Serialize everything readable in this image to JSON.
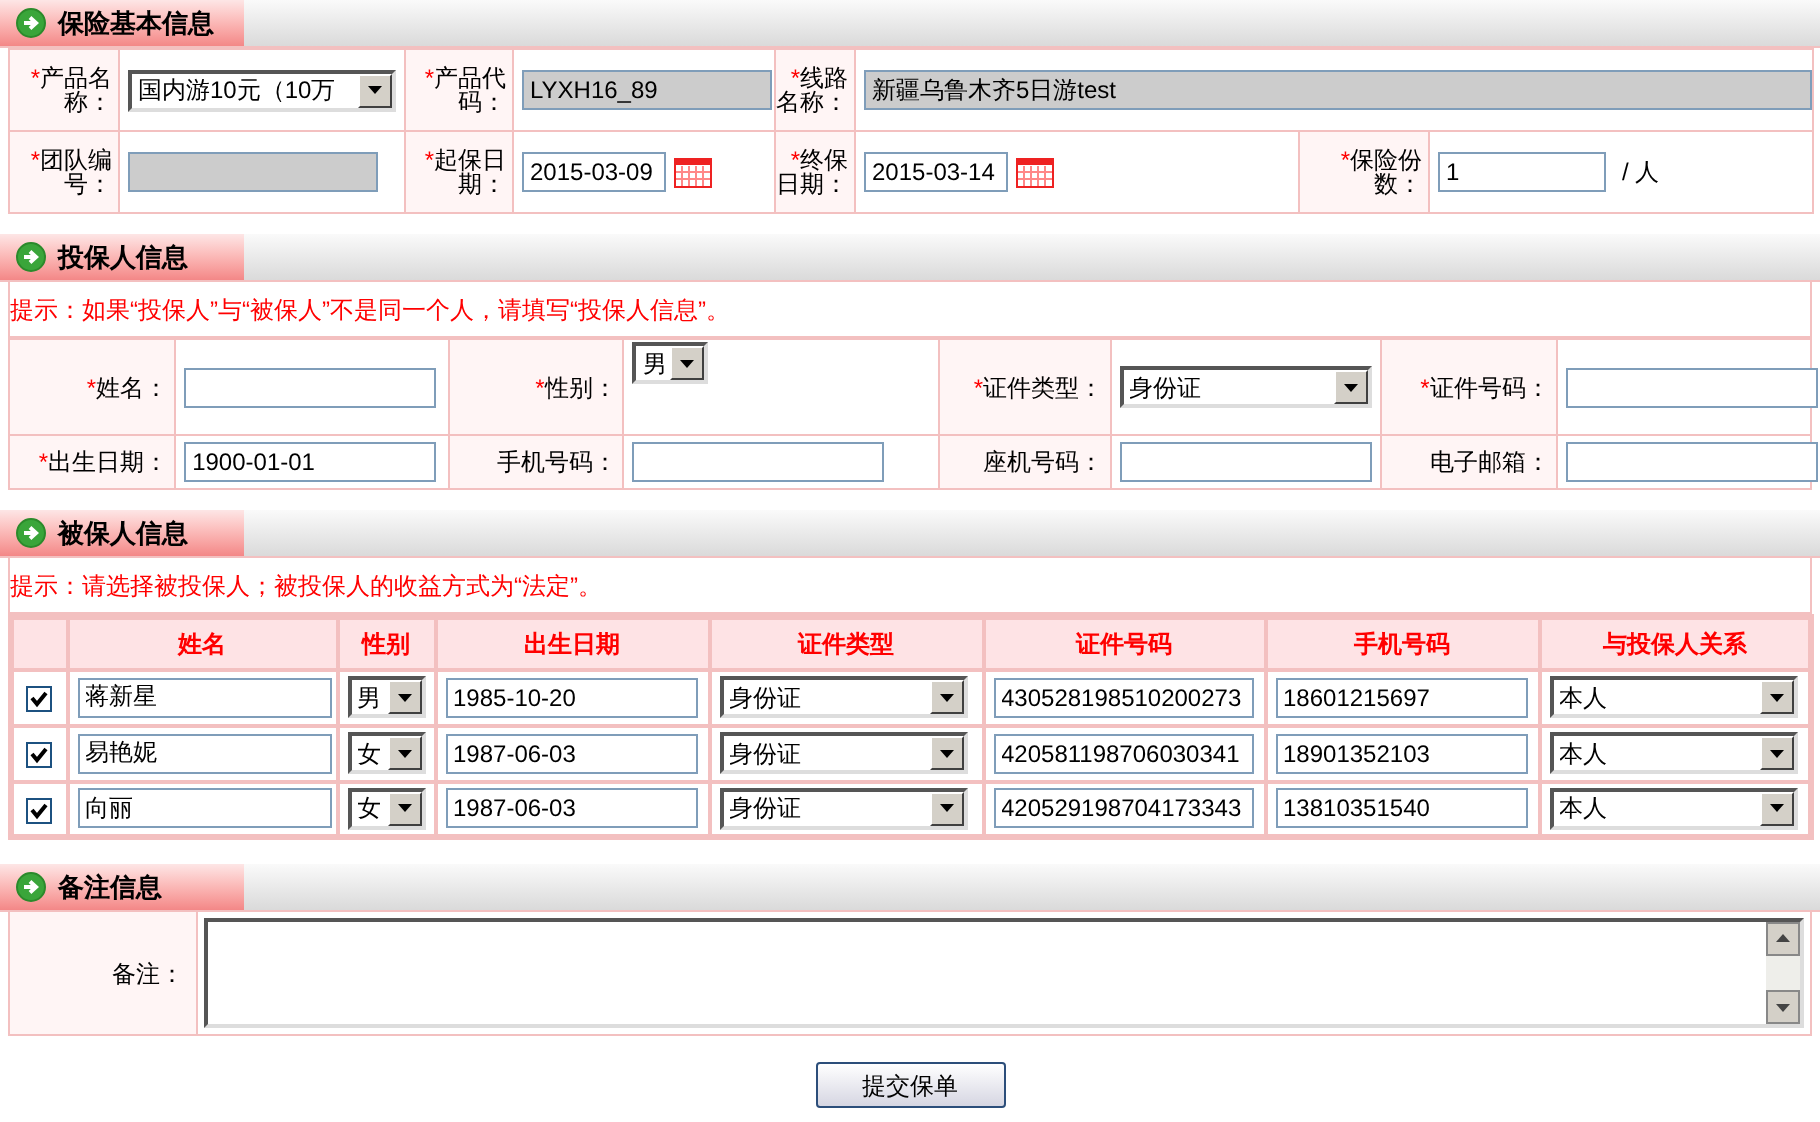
{
  "sections": [
    {
      "kind": "form",
      "title": "保险基本信息",
      "rows": [
        [
          {
            "kind": "select",
            "required_mark": "*",
            "label": "产品名称：",
            "value": "国内游10元（10万"
          },
          {
            "kind": "readonly",
            "required_mark": "*",
            "label": "产品代码：",
            "value": "LYXH16_89"
          },
          {
            "kind": "readonly",
            "required_mark": "*",
            "label": "线路名称：",
            "value": "新疆乌鲁木齐5日游test"
          }
        ],
        [
          {
            "kind": "readonly",
            "required_mark": "*",
            "label": "团队编号："
          },
          {
            "kind": "date",
            "required_mark": "*",
            "label": "起保日期：",
            "value": "2015-03-09"
          },
          {
            "kind": "date",
            "required_mark": "*",
            "label": "终保日期：",
            "value": "2015-03-14"
          },
          {
            "kind": "text",
            "required_mark": "*",
            "label": "保险份数：",
            "value": "1",
            "suffix": "/ 人"
          }
        ]
      ]
    },
    {
      "kind": "form",
      "title": "投保人信息",
      "hint": "提示：如果“投保人”与“被保人”不是同一个人，请填写“投保人信息”。",
      "rows": [
        [
          {
            "kind": "text",
            "required_mark": "*",
            "label": "姓名："
          },
          {
            "kind": "small-select",
            "required_mark": "*",
            "label": "性别：",
            "value": "男"
          },
          {
            "kind": "select",
            "required_mark": "*",
            "label": "证件类型：",
            "value": "身份证"
          },
          {
            "kind": "text",
            "required_mark": "*",
            "label": "证件号码："
          }
        ],
        [
          {
            "kind": "text",
            "required_mark": "*",
            "label": "出生日期：",
            "value": "1900-01-01"
          },
          {
            "kind": "text",
            "label": "手机号码："
          },
          {
            "kind": "text",
            "label": "座机号码："
          },
          {
            "kind": "text",
            "label": "电子邮箱："
          }
        ]
      ]
    },
    {
      "kind": "table",
      "title": "被保人信息",
      "hint": "提示：请选择被投保人；被投保人的收益方式为“法定”。",
      "columns": [
        "姓名",
        "性别",
        "出生日期",
        "证件类型",
        "证件号码",
        "手机号码",
        "与投保人关系"
      ],
      "rows": [
        {
          "checked": true,
          "name": "蒋新星",
          "gender": "男",
          "birth_date": "1985-10-20",
          "id_type": "身份证",
          "id_number": "430528198510200273",
          "mobile": "18601215697",
          "relation": "本人"
        },
        {
          "checked": true,
          "name": "易艳妮",
          "gender": "女",
          "birth_date": "1987-06-03",
          "id_type": "身份证",
          "id_number": "420581198706030341",
          "mobile": "18901352103",
          "relation": "本人"
        },
        {
          "checked": true,
          "name": "向丽",
          "gender": "女",
          "birth_date": "1987-06-03",
          "id_type": "身份证",
          "id_number": "420529198704173343",
          "mobile": "13810351540",
          "relation": "本人"
        }
      ]
    },
    {
      "kind": "remark",
      "title": "备注信息",
      "label": "备注："
    }
  ],
  "submit_button": "提交保单"
}
